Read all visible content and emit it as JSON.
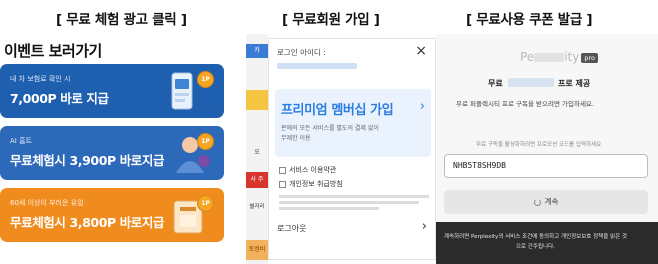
{
  "captions": {
    "panel1": "[ 무료 체험 광고 클릭 ]",
    "panel2": "[ 무료회원 가입 ]",
    "panel3": "[ 무료사용 쿠폰 발급 ]"
  },
  "panel1": {
    "title": "이벤트 보러가기",
    "cards": [
      {
        "small": "내 차 보험료 확인 시",
        "big": "7,000P 바로 지급",
        "coin": "1P",
        "color": "#1f5fb0"
      },
      {
        "small": "AI 홈트",
        "big": "무료체험시 3,900P 바로지급",
        "coin": "1P",
        "color": "#2d69b9"
      },
      {
        "small": "60세 이상이 부러운 유일",
        "big": "무료체험시 3,800P 바로지급",
        "coin": "1P",
        "color": "#f08c1e"
      }
    ]
  },
  "panel2": {
    "id_label": "로그인 아이디 :",
    "close": "×",
    "promo_title": "프리미엄 멤버십 가입",
    "promo_arrow": "›",
    "promo_desc1": "몬에의 모든 서비스를 별도의 결제 없이",
    "promo_desc2": "무제한 이용",
    "check1": "서비스 이용약관",
    "check2": "개인정보 취급방침",
    "logout": "로그아웃",
    "logout_arrow": "›",
    "strip": [
      "카",
      "오",
      "사 주",
      "별자리",
      "토정비"
    ]
  },
  "panel3": {
    "brand_pre": "Pe",
    "brand_post": "ity",
    "pro_tag": "pro",
    "free_a": "무료",
    "free_b": "프로 제공",
    "desc": "무료 퍼플렉시티 프로 구독을 받으려면 가입하세요.",
    "hint": "무료 구독을 활성화하려면 프로모션 코드를 입력하세요",
    "code": "NHB5T8SH9DB",
    "continue": "계속",
    "bottom1": "계속하려면 Perplexity의 서비스 조건에 동의하고 개인정보보호 정책을 읽은 것",
    "bottom2": "으로 간주됩니다."
  }
}
